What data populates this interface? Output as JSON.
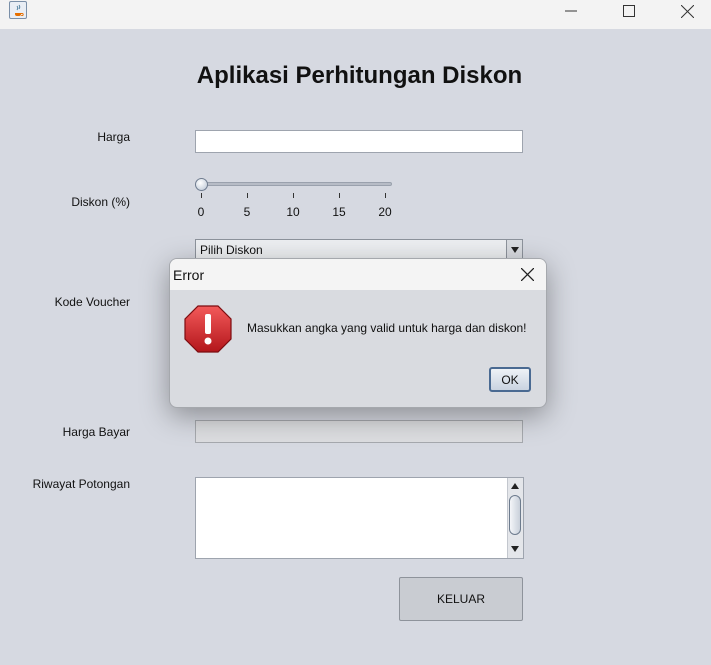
{
  "window": {
    "minimize_icon": "minimize-icon",
    "maximize_icon": "maximize-icon",
    "close_icon": "close-icon"
  },
  "form": {
    "title": "Aplikasi Perhitungan Diskon",
    "harga_label": "Harga",
    "harga_value": "",
    "diskon_label": "Diskon (%)",
    "slider_value": 0,
    "slider_ticks": [
      "0",
      "5",
      "10",
      "15",
      "20"
    ],
    "combo_selected": "Pilih Diskon",
    "kode_voucher_label": "Kode Voucher",
    "harga_bayar_label": "Harga Bayar",
    "harga_bayar_value": "",
    "riwayat_label": "Riwayat Potongan",
    "riwayat_value": "",
    "keluar_label": "KELUAR"
  },
  "dialog": {
    "title": "Error",
    "message": "Masukkan angka yang valid untuk harga dan diskon!",
    "ok_label": "OK",
    "icon": "error-icon"
  }
}
